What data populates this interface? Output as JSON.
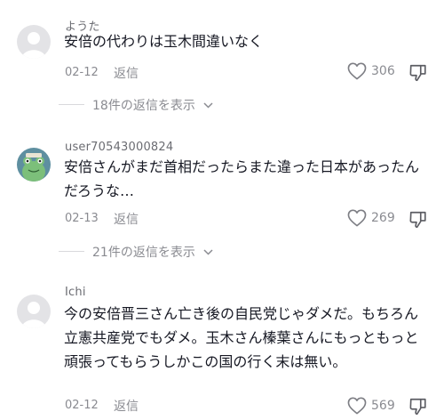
{
  "comments": [
    {
      "username": "ようた",
      "text": "安倍の代わりは玉木間違いなく",
      "date": "02-12",
      "reply_label": "返信",
      "likes": "306",
      "view_replies": "18件の返信を表示",
      "avatar": "default-avatar"
    },
    {
      "username": "user70543000824",
      "text": "安倍さんがまだ首相だったらまた違った日本があったんだろうな…",
      "date": "02-13",
      "reply_label": "返信",
      "likes": "269",
      "view_replies": "21件の返信を表示",
      "avatar": "frog-avatar"
    },
    {
      "username": "Ichi",
      "text": "今の安倍晋三さん亡き後の自民党じゃダメだ。もちろん立憲共産党でもダメ。玉木さん榛葉さんにもっともっと頑張ってもらうしかこの国の行く末は無い。",
      "date": "02-12",
      "reply_label": "返信",
      "likes": "569",
      "avatar": "default-avatar"
    }
  ],
  "colors": {
    "text": "#161823",
    "secondary": "#8a8b91",
    "avatar_bg": "#e3e3e6",
    "frog_bg": "#5e8fa0",
    "frog_body": "#7cbf7a"
  },
  "icons": {
    "like": "heart-outline-icon",
    "dislike": "thumbs-down-outline-icon",
    "expand": "chevron-down-icon"
  }
}
